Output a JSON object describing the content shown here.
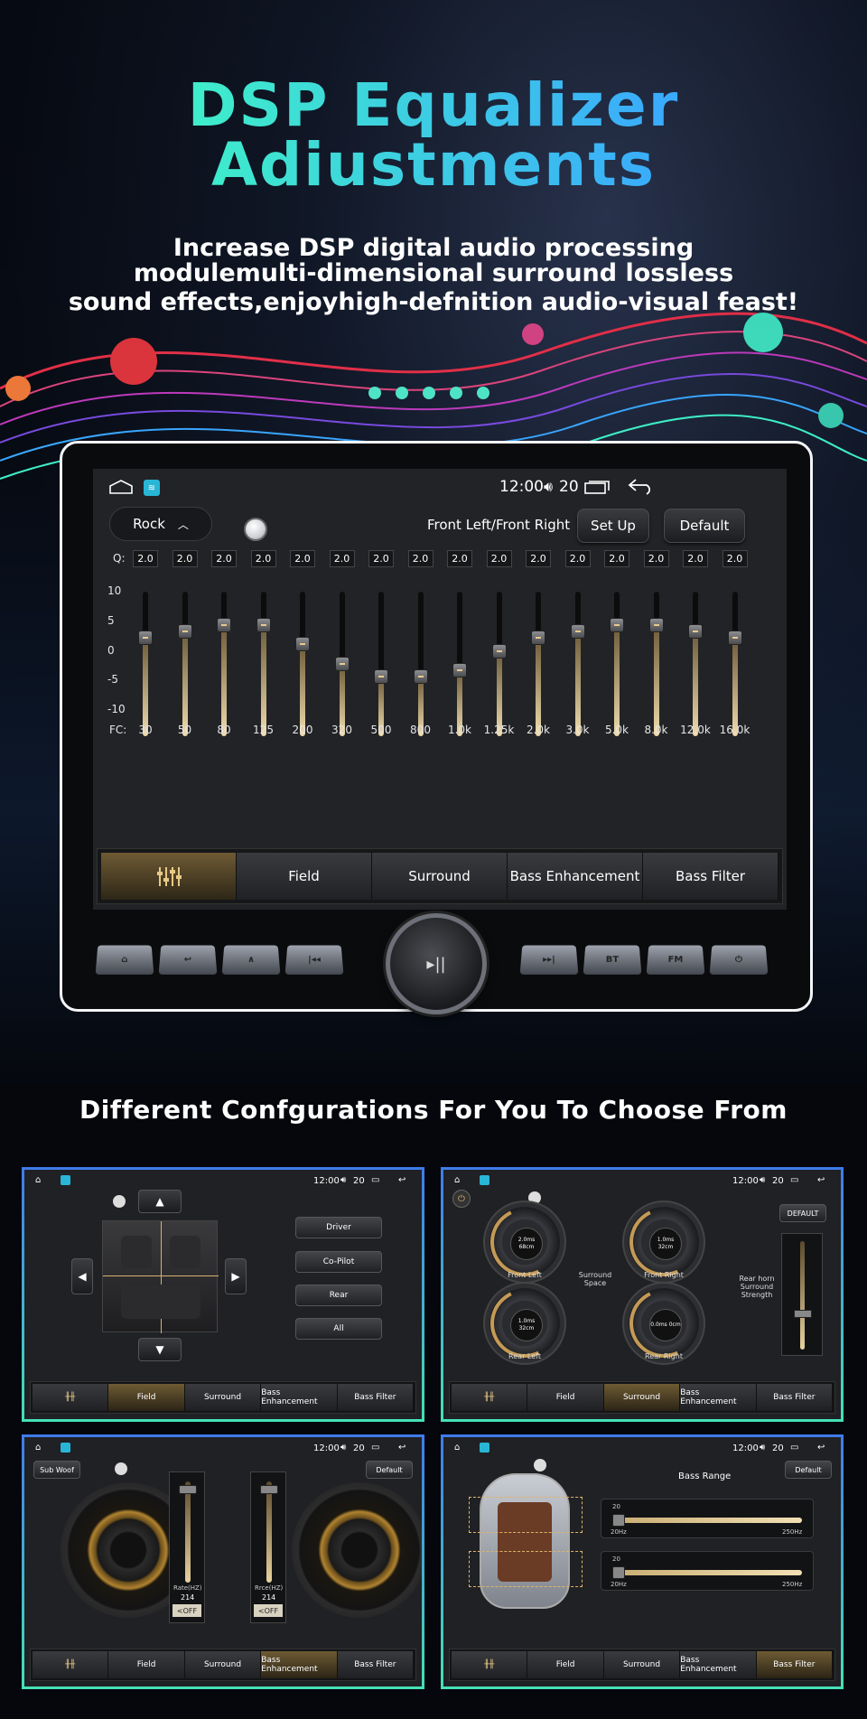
{
  "hero": {
    "title_line1": "DSP Equalizer",
    "title_line2": "Adiustments",
    "sub_line1": "Increase DSP digital audio processing",
    "sub_line2": "modulemulti-dimensional surround lossless",
    "sub_line3": "sound effects,enjoyhigh-defnition audio-visual feast!"
  },
  "colors": {
    "accent_teal": "#3ff0c8",
    "accent_blue": "#3aa7ff",
    "active_tab": "#6e5b34",
    "border_blue": "#3f7bea",
    "border_green": "#45e0b6"
  },
  "device": {
    "status": {
      "time": "12:00",
      "volume": "20"
    },
    "preset": "Rock",
    "channel": "Front Left/Front Right",
    "setup_label": "Set Up",
    "default_label": "Default",
    "q_label": "Q:",
    "fc_label": "FC:",
    "y_ticks": [
      "10",
      "5",
      "0",
      "-5",
      "-10"
    ],
    "bands": [
      {
        "fc": "30",
        "q": "2.0",
        "gain": 4
      },
      {
        "fc": "50",
        "q": "2.0",
        "gain": 5
      },
      {
        "fc": "80",
        "q": "2.0",
        "gain": 6
      },
      {
        "fc": "125",
        "q": "2.0",
        "gain": 6
      },
      {
        "fc": "200",
        "q": "2.0",
        "gain": 3
      },
      {
        "fc": "320",
        "q": "2.0",
        "gain": 0
      },
      {
        "fc": "500",
        "q": "2.0",
        "gain": -2
      },
      {
        "fc": "800",
        "q": "2.0",
        "gain": -2
      },
      {
        "fc": "1.0k",
        "q": "2.0",
        "gain": -1
      },
      {
        "fc": "1.25k",
        "q": "2.0",
        "gain": 2
      },
      {
        "fc": "2.0k",
        "q": "2.0",
        "gain": 4
      },
      {
        "fc": "3.0k",
        "q": "2.0",
        "gain": 5
      },
      {
        "fc": "5.0k",
        "q": "2.0",
        "gain": 6
      },
      {
        "fc": "8.0k",
        "q": "2.0",
        "gain": 6
      },
      {
        "fc": "12.0k",
        "q": "2.0",
        "gain": 5
      },
      {
        "fc": "16.0k",
        "q": "2.0",
        "gain": 4
      }
    ],
    "tabs": [
      "Field",
      "Surround",
      "Bass Enhancement",
      "Bass Filter"
    ]
  },
  "section2": {
    "heading": "Different Confgurations For You To Choose From"
  },
  "panels": {
    "status": {
      "time": "12:00",
      "volume": "20"
    },
    "tabs": [
      "Field",
      "Surround",
      "Bass Enhancement",
      "Bass Filter"
    ],
    "field": {
      "buttons": [
        "Driver",
        "Co-Pilot",
        "Rear",
        "All"
      ]
    },
    "surround": {
      "default_label": "DEFAULT",
      "center_label": "Surround Space",
      "rear_label": "Rear horn Surround Strength",
      "dials": [
        {
          "label": "Front Left",
          "value": "2.0ms 68cm"
        },
        {
          "label": "Front Right",
          "value": "1.0ms 32cm"
        },
        {
          "label": "Rear Left",
          "value": "1.0ms 32cm"
        },
        {
          "label": "Rear Right",
          "value": "0.0ms 0cm"
        }
      ]
    },
    "bass_enh": {
      "subwoof_label": "Sub Woof",
      "default_label": "Default",
      "sliders": [
        {
          "caption": "Rate(HZ)",
          "value": "214",
          "toggle": "<OFF"
        },
        {
          "caption": "Rrce(HZ)",
          "value": "214",
          "toggle": "<OFF"
        }
      ]
    },
    "bass_filter": {
      "default_label": "Default",
      "title": "Bass Range",
      "sliders": [
        {
          "value": "20",
          "min": "20Hz",
          "max": "250Hz"
        },
        {
          "value": "20",
          "min": "20Hz",
          "max": "250Hz"
        }
      ]
    }
  }
}
